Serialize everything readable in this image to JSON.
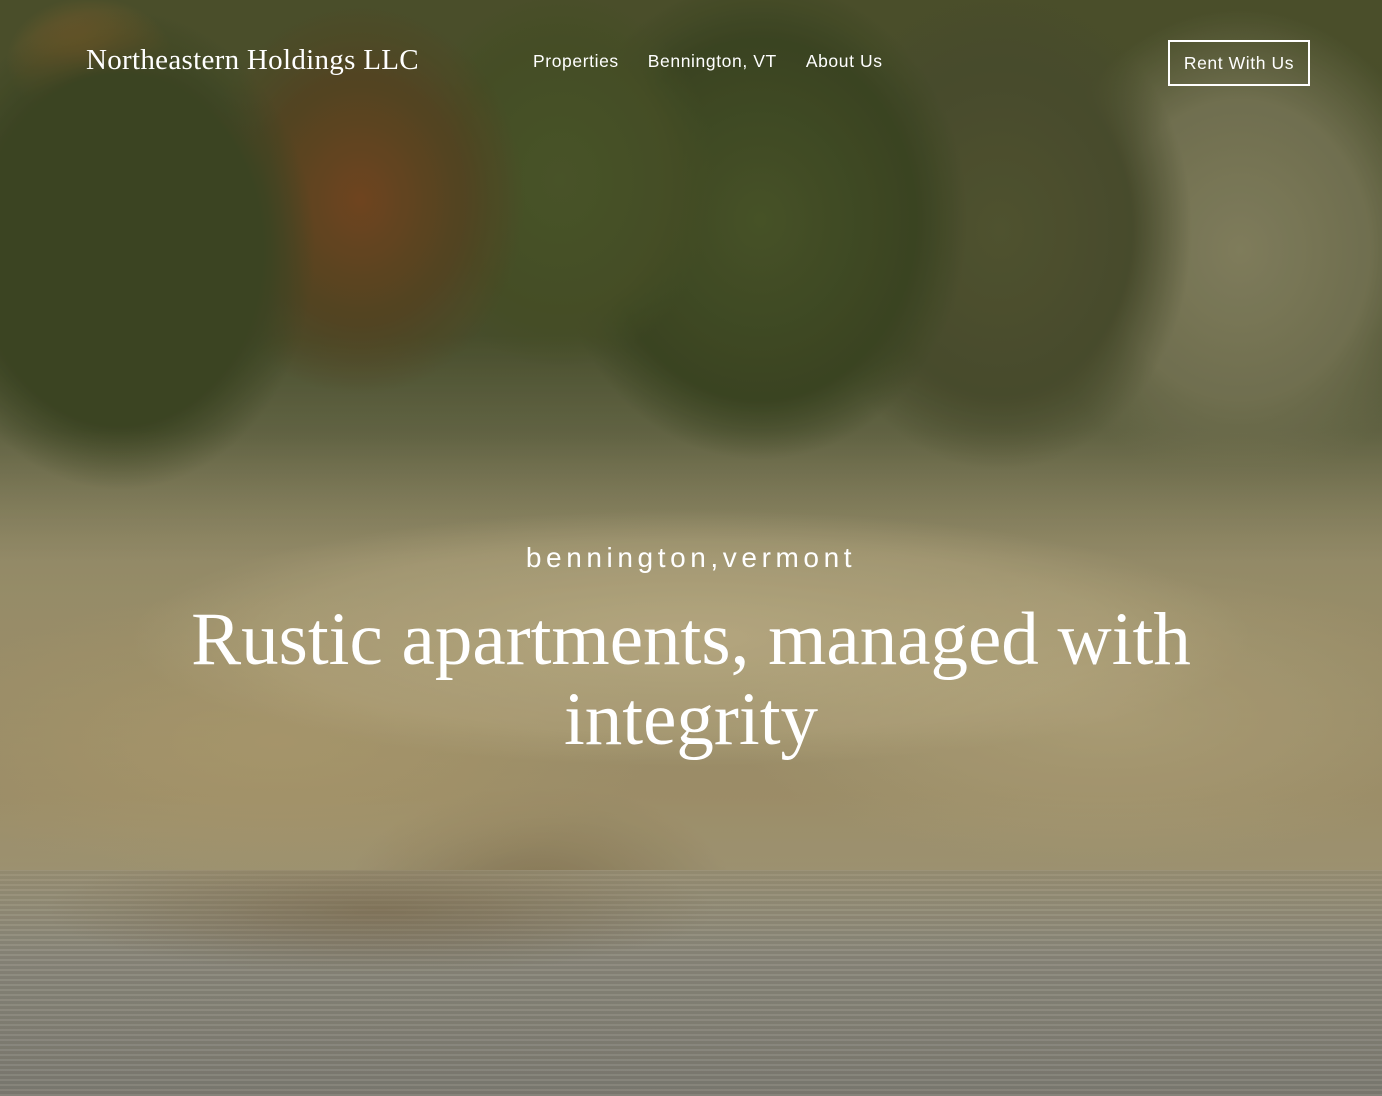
{
  "header": {
    "logo": "Northeastern Holdings LLC",
    "nav": [
      {
        "label": "Properties"
      },
      {
        "label": "Bennington, VT"
      },
      {
        "label": "About Us"
      }
    ],
    "cta_label": "Rent With Us"
  },
  "hero": {
    "eyebrow": "bennington,vermont",
    "headline": "Rustic apartments, managed with integrity"
  }
}
